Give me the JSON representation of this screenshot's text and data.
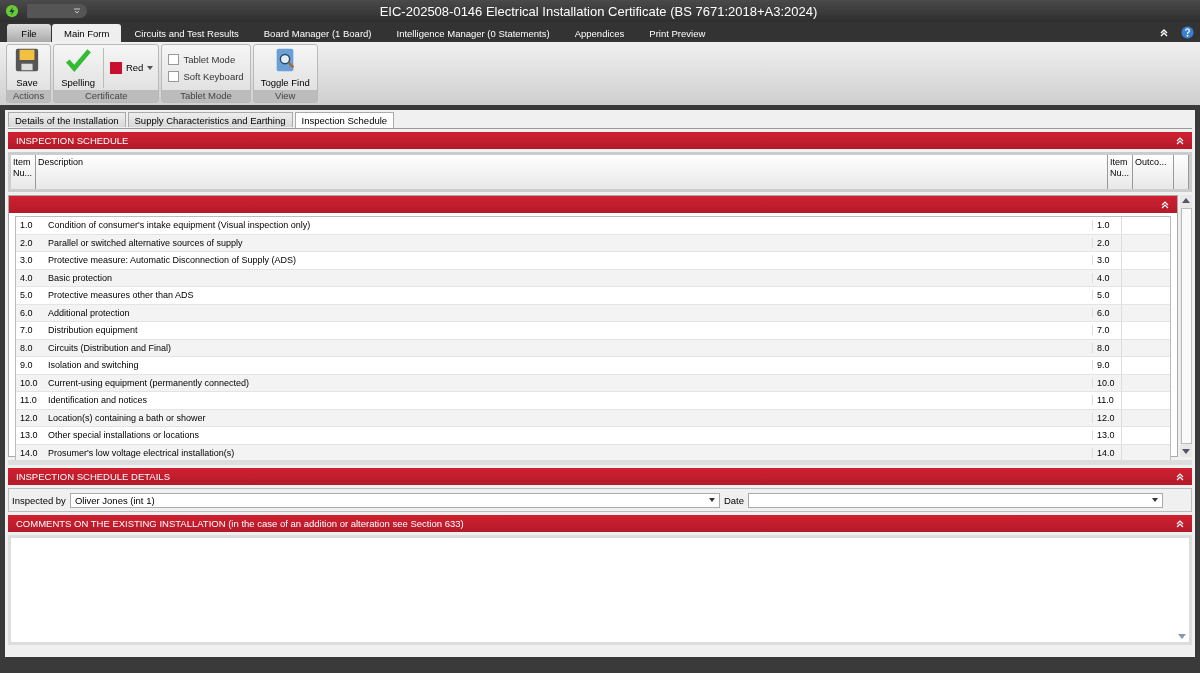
{
  "window": {
    "title": "EIC-202508-0146 Electrical Installation Certificate (BS 7671:2018+A3:2024)"
  },
  "ribbon_tabs": [
    {
      "label": "File",
      "selected": false,
      "kind": "file"
    },
    {
      "label": "Main Form",
      "selected": true,
      "kind": "tab"
    },
    {
      "label": "Circuits and Test Results",
      "selected": false,
      "kind": "tab"
    },
    {
      "label": "Board Manager (1 Board)",
      "selected": false,
      "kind": "tab"
    },
    {
      "label": "Intelligence Manager (0 Statements)",
      "selected": false,
      "kind": "tab"
    },
    {
      "label": "Appendices",
      "selected": false,
      "kind": "tab"
    },
    {
      "label": "Print Preview",
      "selected": false,
      "kind": "tab"
    }
  ],
  "ribbon": {
    "actions": {
      "label": "Actions",
      "save": "Save"
    },
    "certificate": {
      "label": "Certificate",
      "spelling": "Spelling",
      "color_label": "Red"
    },
    "tablet_mode": {
      "label": "Tablet Mode",
      "options": [
        {
          "label": "Tablet Mode",
          "checked": false
        },
        {
          "label": "Soft Keyboard",
          "checked": false
        }
      ]
    },
    "view": {
      "label": "View",
      "toggle_find": "Toggle Find"
    }
  },
  "form_tabs": [
    {
      "label": "Details of the Installation",
      "selected": false
    },
    {
      "label": "Supply Characteristics and Earthing",
      "selected": false
    },
    {
      "label": "Inspection Schedule",
      "selected": true
    }
  ],
  "inspection_schedule": {
    "title": "INSPECTION SCHEDULE",
    "columns": [
      "Item Nu...",
      "Description",
      "Item Nu...",
      "Outco..."
    ]
  },
  "rows": [
    {
      "number": "1.0",
      "description": "Condition of consumer's intake equipment (Visual inspection only)",
      "number_2": "1.0"
    },
    {
      "number": "2.0",
      "description": "Parallel or switched alternative sources of supply",
      "number_2": "2.0"
    },
    {
      "number": "3.0",
      "description": "Protective measure: Automatic Disconnection of Supply (ADS)",
      "number_2": "3.0"
    },
    {
      "number": "4.0",
      "description": "Basic protection",
      "number_2": "4.0"
    },
    {
      "number": "5.0",
      "description": "Protective measures other than ADS",
      "number_2": "5.0"
    },
    {
      "number": "6.0",
      "description": "Additional protection",
      "number_2": "6.0"
    },
    {
      "number": "7.0",
      "description": "Distribution equipment",
      "number_2": "7.0"
    },
    {
      "number": "8.0",
      "description": "Circuits (Distribution and Final)",
      "number_2": "8.0"
    },
    {
      "number": "9.0",
      "description": "Isolation and switching",
      "number_2": "9.0"
    },
    {
      "number": "10.0",
      "description": "Current-using equipment (permanently connected)",
      "number_2": "10.0"
    },
    {
      "number": "11.0",
      "description": "Identification and notices",
      "number_2": "11.0"
    },
    {
      "number": "12.0",
      "description": "Location(s) containing a bath or shower",
      "number_2": "12.0"
    },
    {
      "number": "13.0",
      "description": "Other special installations or locations",
      "number_2": "13.0"
    },
    {
      "number": "14.0",
      "description": "Prosumer's low voltage electrical installation(s)",
      "number_2": "14.0"
    }
  ],
  "details": {
    "title": "INSPECTION SCHEDULE DETAILS",
    "inspected_by_label": "Inspected by",
    "inspected_by": "Oliver Jones (int 1)",
    "date_label": "Date"
  },
  "comments": {
    "title": "COMMENTS ON THE EXISTING INSTALLATION (in the case of an addition or alteration see Section 633)"
  }
}
